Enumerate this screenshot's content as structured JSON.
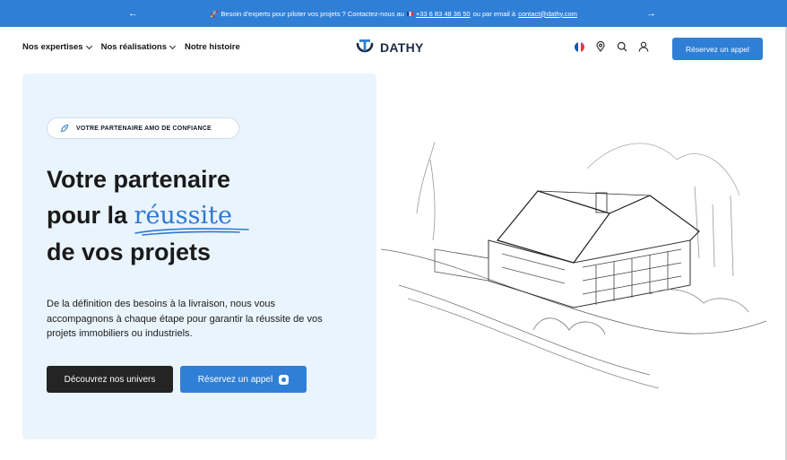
{
  "topbar": {
    "prev_arrow": "←",
    "next_arrow": "→",
    "message_pre": "Besoin d'experts pour piloter vos projets ? Contactez-nous au",
    "phone": "+33 6 83 48 36 50",
    "message_mid": "ou par email à",
    "email": "contact@dathy.com"
  },
  "nav": {
    "items": [
      {
        "label": "Nos expertises",
        "has_dropdown": true
      },
      {
        "label": "Nos réalisations",
        "has_dropdown": true
      },
      {
        "label": "Notre histoire",
        "has_dropdown": false
      }
    ]
  },
  "logo": {
    "text": "DATHY"
  },
  "header_tools": {
    "language_icon": "france-flag-icon",
    "location_icon": "map-pin-icon",
    "search_icon": "search-icon",
    "account_icon": "user-icon",
    "cta_label": "Réservez un appel"
  },
  "hero": {
    "badge_icon": "rocket-icon",
    "badge_text": "VOTRE PARTENAIRE AMO DE CONFIANCE",
    "title_line1": "Votre partenaire",
    "title_line2_pre": "pour la",
    "title_highlight": "réussite",
    "title_line3": "de vos projets",
    "description": "De la définition des besoins à la livraison, nous vous accompagnons à chaque étape pour garantir la réussite de vos projets immobiliers ou industriels.",
    "primary_button": "Découvrez nos univers",
    "secondary_button": "Réservez un appel"
  },
  "colors": {
    "accent": "#2f7fd6",
    "hero_background": "#eaf4fd",
    "dark_button": "#242424",
    "logo_navy": "#1c2a44"
  }
}
